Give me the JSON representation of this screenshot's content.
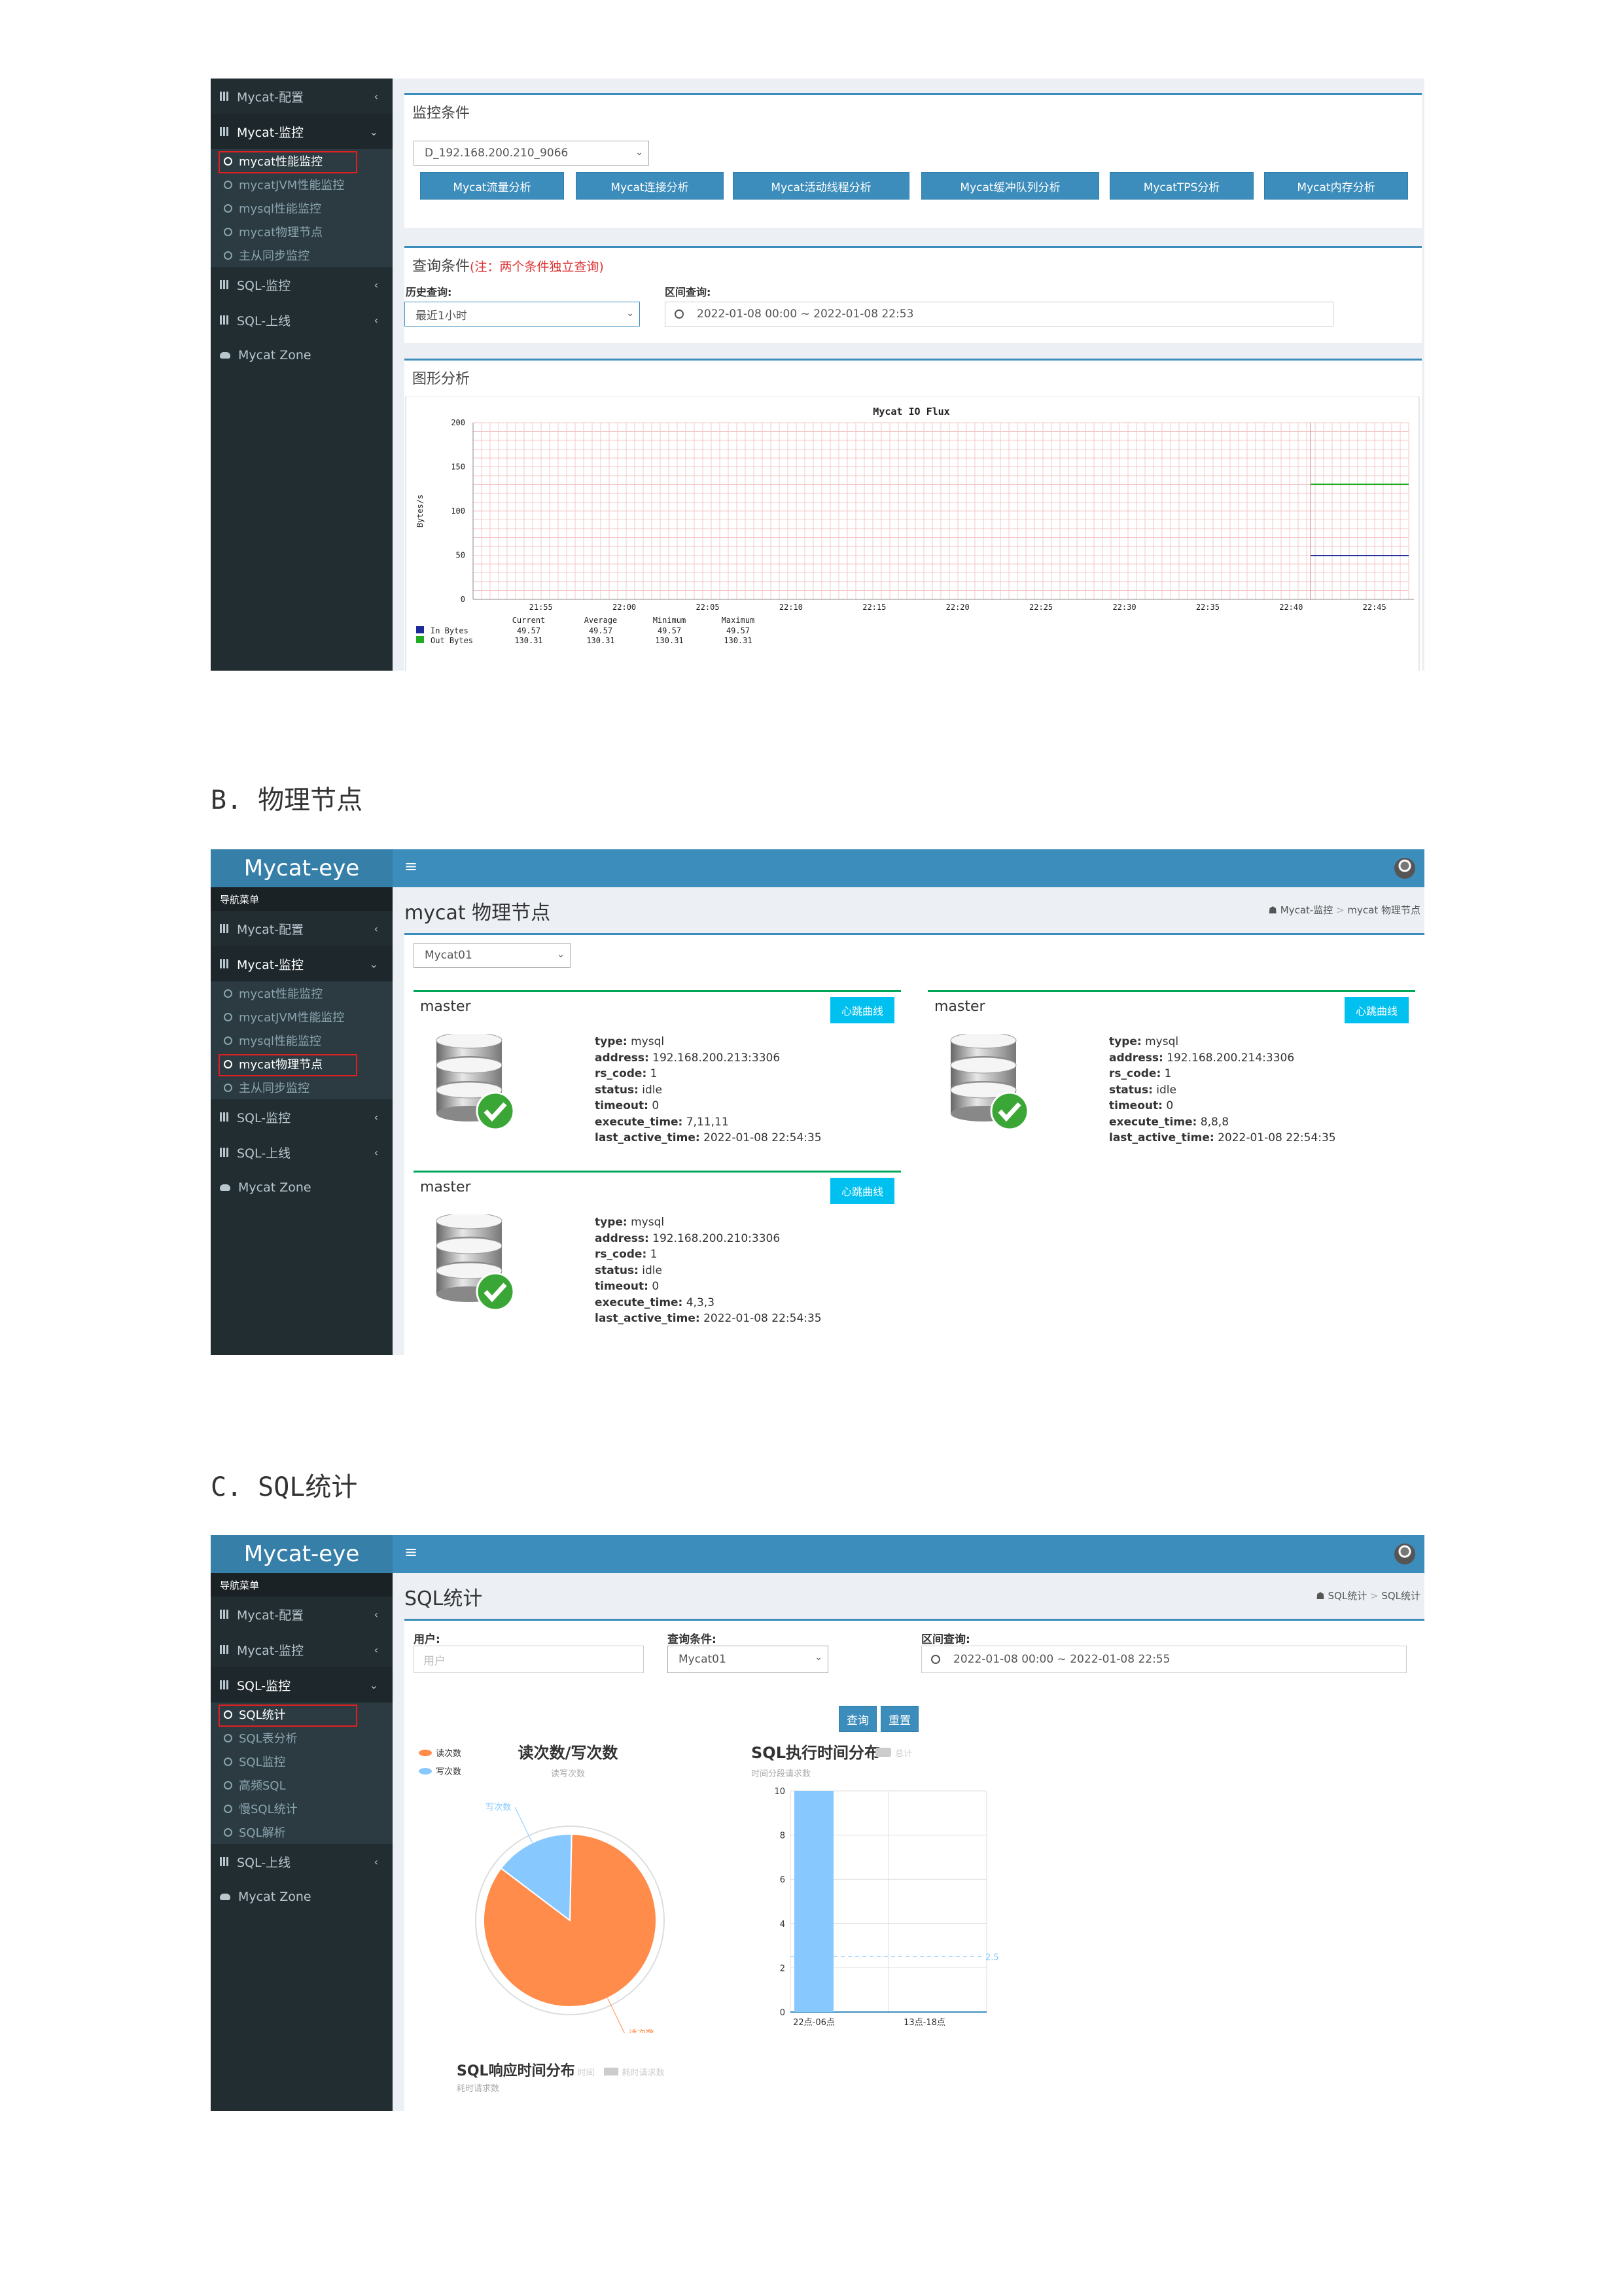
{
  "section_b": {
    "marker": "B.",
    "title": "物理节点"
  },
  "section_c": {
    "marker": "C.",
    "title": "SQL统计"
  },
  "brand": "Mycat-eye",
  "nav_header": "导航菜单",
  "menu": {
    "mycat_config": "Mycat-配置",
    "mycat_monitor": "Mycat-监控",
    "sql_monitor": "SQL-监控",
    "sql_online": "SQL-上线",
    "zone": "Mycat Zone"
  },
  "mycat_monitor_items": [
    "mycat性能监控",
    "mycatJVM性能监控",
    "mysql性能监控",
    "mycat物理节点",
    "主从同步监控"
  ],
  "sql_monitor_items": [
    "SQL统计",
    "SQL表分析",
    "SQL监控",
    "高频SQL",
    "慢SQL统计",
    "SQL解析"
  ],
  "panel_a": {
    "monitor_title": "监控条件",
    "datasource": "D_192.168.200.210_9066",
    "buttons": [
      "Mycat流量分析",
      "Mycat连接分析",
      "Mycat活动线程分析",
      "Mycat缓冲队列分析",
      "MycatTPS分析",
      "Mycat内存分析"
    ],
    "query_title": "查询条件",
    "query_note": "(注：两个条件独立查询)",
    "history_label": "历史查询:",
    "history_value": "最近1小时",
    "range_label": "区间查询:",
    "range_value": "2022-01-08 00:00 ~ 2022-01-08 22:53",
    "graph_title": "图形分析",
    "chart_title": "Mycat IO Flux",
    "legend_header": [
      "Current",
      "Average",
      "Minimum",
      "Maximum"
    ],
    "legend_rows": [
      {
        "name": "In Bytes",
        "values": [
          "49.57",
          "49.57",
          "49.57",
          "49.57"
        ]
      },
      {
        "name": "Out Bytes",
        "values": [
          "130.31",
          "130.31",
          "130.31",
          "130.31"
        ]
      }
    ]
  },
  "chart_data": [
    {
      "type": "line",
      "title": "Mycat IO Flux",
      "ylabel": "Bytes/s",
      "ylim": [
        0,
        200
      ],
      "yticks": [
        "0",
        "50",
        "100",
        "150",
        "200"
      ],
      "xticks": [
        "21:55",
        "22:00",
        "22:05",
        "22:10",
        "22:15",
        "22:20",
        "22:25",
        "22:30",
        "22:35",
        "22:40",
        "22:45"
      ],
      "series": [
        {
          "name": "In Bytes",
          "color": "#1a2a9a",
          "value": 49.57
        },
        {
          "name": "Out Bytes",
          "color": "#22aa22",
          "value": 130.31
        }
      ]
    },
    {
      "type": "pie",
      "title": "读次数/写次数",
      "subtitle": "读写次数",
      "legend": [
        "读次数",
        "写次数"
      ],
      "labels": [
        "读次数",
        "写次数"
      ],
      "values": [
        85,
        15
      ],
      "colors": [
        "#ff8c4b",
        "#87c9ff"
      ]
    },
    {
      "type": "bar",
      "title": "SQL执行时间分布",
      "subtitle": "时间分段请求数",
      "legend": [
        "总计"
      ],
      "categories": [
        "22点-06点",
        "13点-18点"
      ],
      "values": [
        10,
        0
      ],
      "yticks": [
        "0",
        "2",
        "4",
        "6",
        "8",
        "10"
      ],
      "ylim": [
        0,
        10
      ],
      "average_label": "2.5",
      "average": 2.5
    }
  ],
  "panel_b": {
    "page_title": "mycat 物理节点",
    "breadcrumb": [
      "Mycat-监控",
      "mycat 物理节点"
    ],
    "node_select": "Mycat01",
    "heartbeat": "心跳曲线",
    "nodes": [
      {
        "title": "master",
        "type": "mysql",
        "address": "192.168.200.213:3306",
        "rs_code": "1",
        "status": "idle",
        "timeout": "0",
        "execute_time": "7,11,11",
        "last_active_time": "2022-01-08 22:54:35"
      },
      {
        "title": "master",
        "type": "mysql",
        "address": "192.168.200.214:3306",
        "rs_code": "1",
        "status": "idle",
        "timeout": "0",
        "execute_time": "8,8,8",
        "last_active_time": "2022-01-08 22:54:35"
      },
      {
        "title": "master",
        "type": "mysql",
        "address": "192.168.200.210:3306",
        "rs_code": "1",
        "status": "idle",
        "timeout": "0",
        "execute_time": "4,3,3",
        "last_active_time": "2022-01-08 22:54:35"
      }
    ],
    "field_labels": {
      "type": "type:",
      "address": "address:",
      "rs_code": "rs_code:",
      "status": "status:",
      "timeout": "timeout:",
      "execute_time": "execute_time:",
      "last_active_time": "last_active_time:"
    }
  },
  "panel_c": {
    "page_title": "SQL统计",
    "breadcrumb": [
      "SQL统计",
      "SQL统计"
    ],
    "user_label": "用户:",
    "user_placeholder": "用户",
    "cond_label": "查询条件:",
    "cond_value": "Mycat01",
    "range_label": "区间查询:",
    "range_value": "2022-01-08 00:00 ~ 2022-01-08 22:55",
    "query_button": "查询",
    "reset_button": "重置",
    "resp_title": "SQL响应时间分布",
    "resp_legend": [
      "时间",
      "耗时请求数"
    ],
    "resp_subtitle": "耗时请求数"
  }
}
